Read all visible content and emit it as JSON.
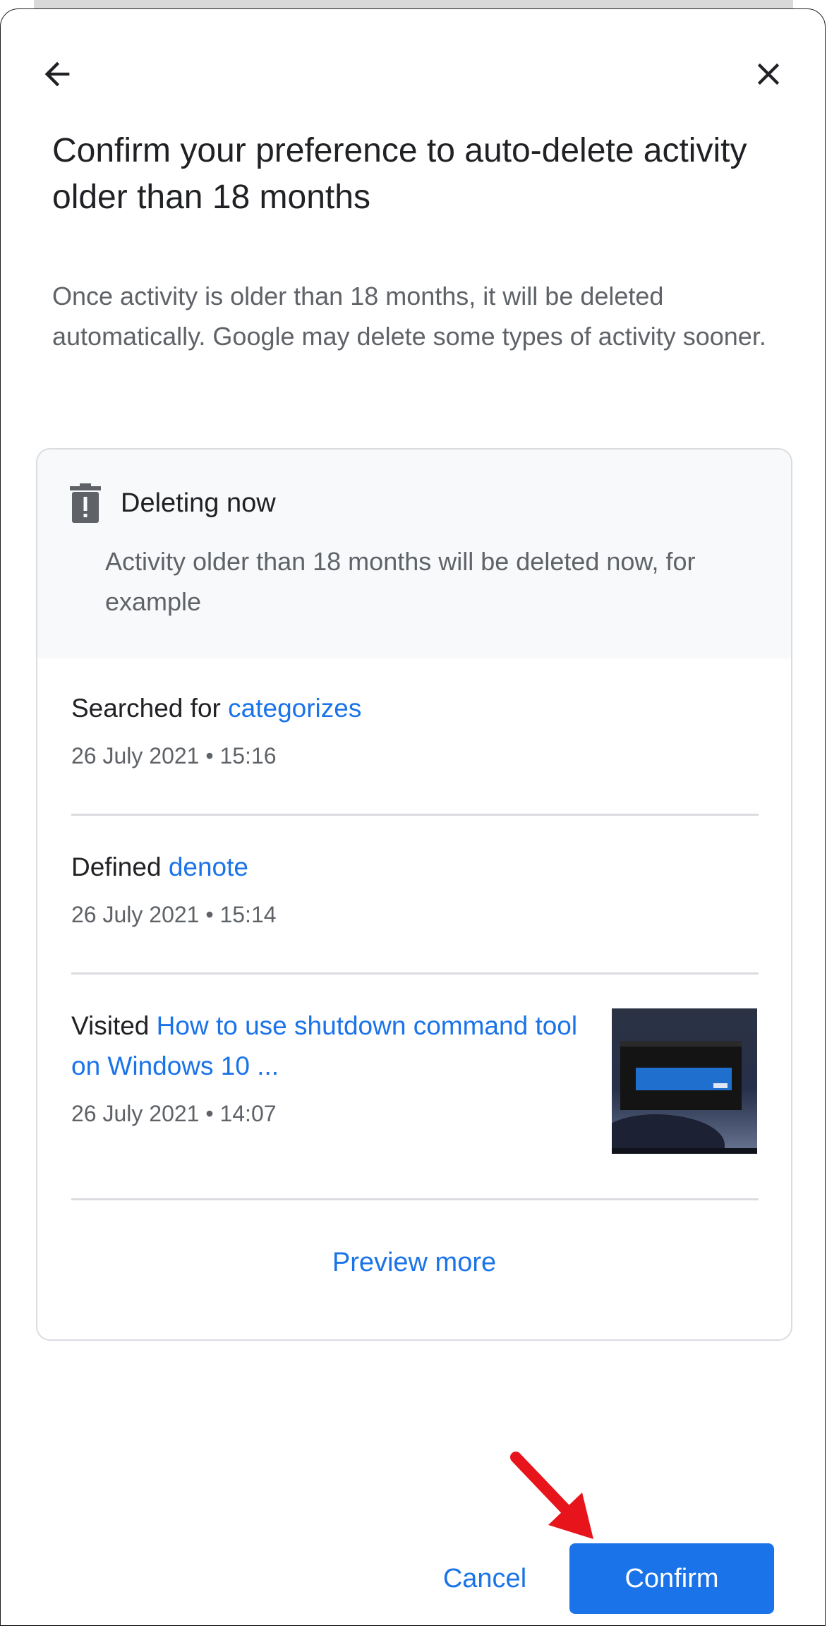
{
  "dialog": {
    "title": "Confirm your preference to auto-delete activity older than 18 months",
    "description": "Once activity is older than 18 months, it will be deleted automatically. Google may delete some types of activity sooner.",
    "back_icon": "arrow-back-icon",
    "close_icon": "close-icon"
  },
  "card": {
    "icon": "trash-warning-icon",
    "heading": "Deleting now",
    "subtext": "Activity older than 18 months will be deleted now, for example",
    "items": [
      {
        "prefix": "Searched for ",
        "link": "categorizes",
        "date": "26 July 2021 • 15:16"
      },
      {
        "prefix": "Defined ",
        "link": "denote",
        "date": "26 July 2021 • 15:14"
      },
      {
        "prefix": "Visited ",
        "link": "How to use shutdown command tool on Windows 10 ...",
        "date": "26 July 2021 • 14:07"
      }
    ],
    "preview_more": "Preview more"
  },
  "actions": {
    "cancel_label": "Cancel",
    "confirm_label": "Confirm"
  },
  "colors": {
    "accent": "#1a73e8",
    "annotation_arrow": "#e8141c",
    "card_header_bg": "#f8f9fa"
  }
}
